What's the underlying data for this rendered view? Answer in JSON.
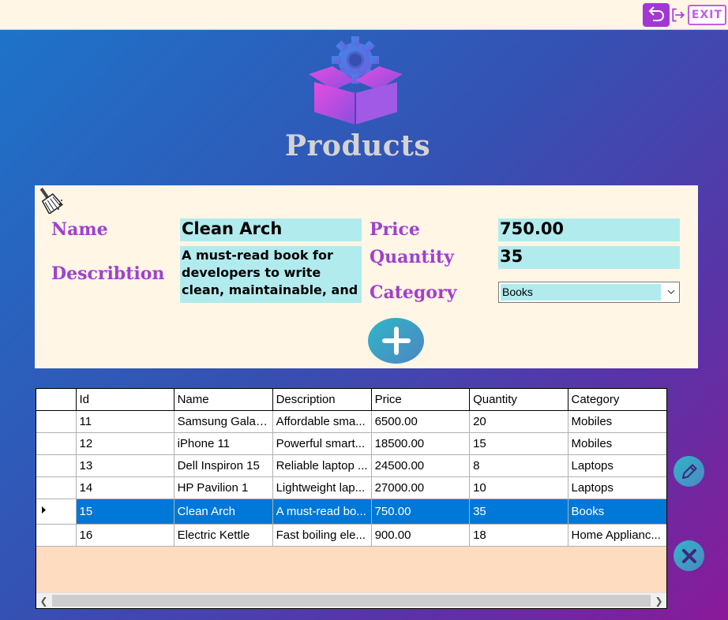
{
  "window": {
    "exit_label": "EXIT"
  },
  "header": {
    "title": "Products"
  },
  "form": {
    "name_label": "Name",
    "name_value": "Clean Arch",
    "description_label": "Describtion",
    "description_value": "A must-read book for developers to write clean, maintainable, and",
    "price_label": "Price",
    "price_value": "750.00",
    "quantity_label": "Quantity",
    "quantity_value": "35",
    "category_label": "Category",
    "category_value": "Books"
  },
  "table": {
    "columns": [
      "Id",
      "Name",
      "Description",
      "Price",
      "Quantity",
      "Category"
    ],
    "selected_row": 4,
    "rows": [
      {
        "id": "11",
        "name": "Samsung Galax...",
        "description": "Affordable sma...",
        "price": "6500.00",
        "quantity": "20",
        "category": "Mobiles"
      },
      {
        "id": "12",
        "name": "iPhone 11",
        "description": "Powerful smart...",
        "price": "18500.00",
        "quantity": "15",
        "category": "Mobiles"
      },
      {
        "id": "13",
        "name": "Dell Inspiron 15",
        "description": "Reliable laptop ...",
        "price": "24500.00",
        "quantity": "8",
        "category": "Laptops"
      },
      {
        "id": "14",
        "name": "HP Pavilion 1",
        "description": "Lightweight lap...",
        "price": "27000.00",
        "quantity": "10",
        "category": "Laptops"
      },
      {
        "id": "15",
        "name": "Clean Arch",
        "description": "A must-read bo...",
        "price": "750.00",
        "quantity": "35",
        "category": "Books"
      },
      {
        "id": "16",
        "name": "Electric Kettle",
        "description": "Fast boiling ele...",
        "price": "900.00",
        "quantity": "18",
        "category": "Home Applianc..."
      }
    ]
  },
  "icons": {
    "back": "undo-arrow-icon",
    "exit": "exit-door-icon",
    "logo": "product-box-gear-icon",
    "clear": "broom-icon",
    "add": "plus-icon",
    "edit": "pencil-icon",
    "delete": "x-icon"
  },
  "colors": {
    "accent_purple": "#a23fcf",
    "field_bg": "#b2ebee",
    "selection": "#0078d7",
    "grid_bg": "#fedcc0"
  }
}
